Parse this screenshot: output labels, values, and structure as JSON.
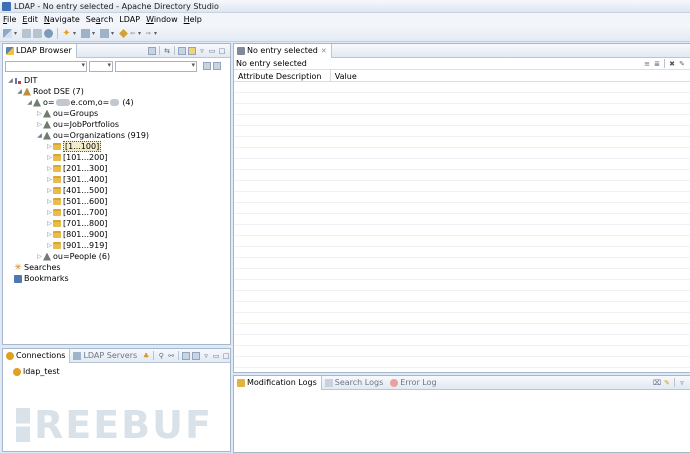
{
  "window": {
    "title": "LDAP - No entry selected - Apache Directory Studio"
  },
  "menu": [
    {
      "label": "File",
      "mnemonic": "F",
      "rest": "ile"
    },
    {
      "label": "Edit",
      "mnemonic": "E",
      "rest": "dit"
    },
    {
      "label": "Navigate",
      "mnemonic": "N",
      "rest": "avigate"
    },
    {
      "label": "Search",
      "mnemonic": "a",
      "pre": "Se",
      "rest": "rch"
    },
    {
      "label": "LDAP",
      "mnemonic": "",
      "rest": "LDAP"
    },
    {
      "label": "Window",
      "mnemonic": "W",
      "rest": "indow"
    },
    {
      "label": "Help",
      "mnemonic": "H",
      "rest": "elp"
    }
  ],
  "browser": {
    "tab_label": "LDAP Browser",
    "tree": {
      "dit": "DIT",
      "root_dse": "Root DSE (7)",
      "base_dn_prefix": "o=",
      "base_dn_middle": "e.com,o=",
      "base_dn_count": "(4)",
      "groups": "ou=Groups",
      "jobportfolios": "ou=JobPortfolios",
      "organizations": "ou=Organizations (919)",
      "ranges": [
        "[1...100]",
        "[101...200]",
        "[201...300]",
        "[301...400]",
        "[401...500]",
        "[501...600]",
        "[601...700]",
        "[701...800]",
        "[801...900]",
        "[901...919]"
      ],
      "people": "ou=People (6)",
      "searches": "Searches",
      "bookmarks": "Bookmarks"
    }
  },
  "connections": {
    "tab_connections": "Connections",
    "tab_servers": "LDAP Servers",
    "items": [
      "ldap_test"
    ]
  },
  "editor": {
    "tab_label": "No entry selected",
    "header": "No entry selected",
    "columns": [
      "Attribute Description",
      "Value"
    ]
  },
  "bottom": {
    "tabs": [
      "Modification Logs",
      "Search Logs",
      "Error Log"
    ]
  },
  "watermark": {
    "text": "REEBUF"
  }
}
